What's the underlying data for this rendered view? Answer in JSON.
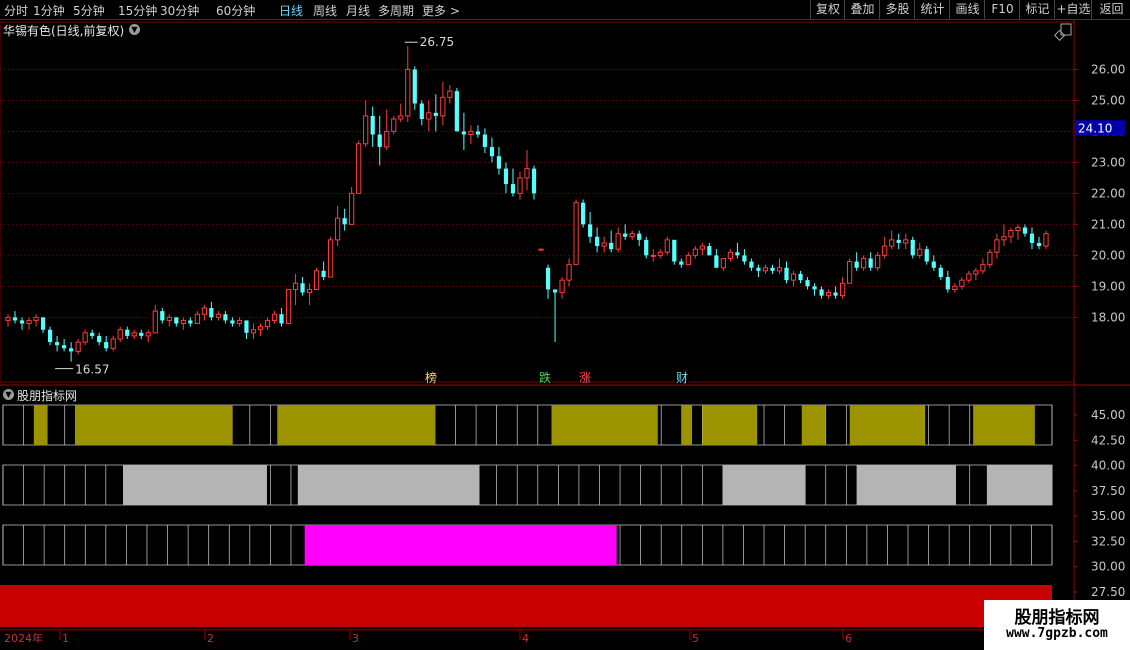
{
  "toolbar": {
    "periods": [
      "分时",
      "1分钟",
      "5分钟",
      "15分钟",
      "30分钟",
      "60分钟",
      "日线",
      "周线",
      "月线",
      "多周期",
      "更多 >"
    ],
    "active_period": "日线",
    "actions": [
      "复权",
      "叠加",
      "多股",
      "统计",
      "画线",
      "F10",
      "标记",
      "+自选",
      "返回"
    ]
  },
  "stock": {
    "title": "华锡有色(日线,前复权)",
    "last_price_label": "24.10",
    "max_label": "26.75",
    "min_label": "16.57"
  },
  "price_axis_labels": [
    "26.00",
    "25.00",
    "24.00",
    "23.00",
    "22.00",
    "21.00",
    "20.00",
    "19.00",
    "18.00"
  ],
  "event_markers": [
    {
      "label": "榜",
      "color": "#ffd27a"
    },
    {
      "label": "跌",
      "color": "#4cd84c"
    },
    {
      "label": "涨",
      "color": "#ff4a4a"
    },
    {
      "label": "财",
      "color": "#6ad7ff"
    }
  ],
  "indicator": {
    "title": "股朋指标网",
    "axis_labels": [
      "45.00",
      "42.50",
      "40.00",
      "37.50",
      "35.00",
      "32.50",
      "30.00",
      "27.50"
    ]
  },
  "time_axis": {
    "labels": [
      "2024年",
      "1",
      "2",
      "3",
      "4",
      "5",
      "6"
    ]
  },
  "watermark": {
    "title": "股朋指标网",
    "url": "www.7gpzb.com"
  },
  "colors": {
    "up": "#ff3c3c",
    "down": "#54ffff",
    "olive": "#9b9400",
    "gray": "#b4b4b4",
    "magenta": "#ff00ff",
    "red_band": "#c80000"
  },
  "chart_data": {
    "type": "candlestick",
    "ohlc": [
      [
        17.9,
        18.1,
        17.7,
        18.0
      ],
      [
        18.0,
        18.2,
        17.8,
        17.9
      ],
      [
        17.9,
        18.0,
        17.6,
        17.8
      ],
      [
        17.8,
        18.0,
        17.6,
        17.9
      ],
      [
        17.9,
        18.1,
        17.7,
        18.0
      ],
      [
        18.0,
        18.0,
        17.5,
        17.6
      ],
      [
        17.6,
        17.7,
        17.1,
        17.2
      ],
      [
        17.2,
        17.4,
        16.9,
        17.1
      ],
      [
        17.1,
        17.3,
        16.9,
        17.0
      ],
      [
        17.0,
        17.2,
        16.57,
        16.9
      ],
      [
        16.9,
        17.3,
        16.8,
        17.2
      ],
      [
        17.2,
        17.6,
        17.1,
        17.5
      ],
      [
        17.5,
        17.6,
        17.3,
        17.4
      ],
      [
        17.4,
        17.5,
        17.1,
        17.2
      ],
      [
        17.2,
        17.4,
        16.9,
        17.0
      ],
      [
        17.0,
        17.4,
        16.9,
        17.3
      ],
      [
        17.3,
        17.7,
        17.2,
        17.6
      ],
      [
        17.6,
        17.7,
        17.3,
        17.4
      ],
      [
        17.4,
        17.6,
        17.3,
        17.5
      ],
      [
        17.5,
        17.6,
        17.3,
        17.4
      ],
      [
        17.4,
        17.6,
        17.2,
        17.5
      ],
      [
        17.5,
        18.4,
        17.5,
        18.2
      ],
      [
        18.2,
        18.3,
        17.8,
        17.9
      ],
      [
        17.9,
        18.1,
        17.7,
        18.0
      ],
      [
        18.0,
        18.0,
        17.7,
        17.8
      ],
      [
        17.8,
        18.0,
        17.6,
        17.9
      ],
      [
        17.9,
        18.0,
        17.7,
        17.8
      ],
      [
        17.8,
        18.2,
        17.8,
        18.1
      ],
      [
        18.1,
        18.4,
        17.9,
        18.3
      ],
      [
        18.3,
        18.5,
        17.9,
        18.0
      ],
      [
        18.0,
        18.2,
        17.9,
        18.1
      ],
      [
        18.1,
        18.2,
        17.8,
        17.9
      ],
      [
        17.9,
        18.0,
        17.7,
        17.8
      ],
      [
        17.8,
        18.0,
        17.7,
        17.9
      ],
      [
        17.9,
        17.9,
        17.3,
        17.5
      ],
      [
        17.5,
        17.8,
        17.3,
        17.6
      ],
      [
        17.6,
        17.8,
        17.4,
        17.7
      ],
      [
        17.7,
        18.0,
        17.6,
        17.9
      ],
      [
        17.9,
        18.2,
        17.8,
        18.1
      ],
      [
        18.1,
        18.3,
        17.7,
        17.8
      ],
      [
        17.8,
        18.8,
        17.8,
        18.9
      ],
      [
        18.9,
        19.4,
        18.4,
        19.1
      ],
      [
        19.1,
        19.3,
        18.7,
        18.8
      ],
      [
        18.8,
        19.1,
        18.4,
        18.9
      ],
      [
        18.9,
        19.6,
        18.9,
        19.5
      ],
      [
        19.5,
        19.8,
        19.2,
        19.3
      ],
      [
        19.3,
        20.6,
        19.3,
        20.5
      ],
      [
        20.5,
        21.6,
        20.3,
        21.2
      ],
      [
        21.2,
        21.5,
        20.8,
        21.0
      ],
      [
        21.0,
        22.2,
        21.0,
        22.0
      ],
      [
        22.0,
        23.7,
        22.0,
        23.6
      ],
      [
        23.6,
        25.0,
        23.5,
        24.5
      ],
      [
        24.5,
        24.8,
        23.5,
        23.9
      ],
      [
        23.9,
        24.5,
        22.9,
        23.5
      ],
      [
        23.5,
        24.7,
        23.4,
        24.0
      ],
      [
        24.0,
        24.5,
        23.9,
        24.4
      ],
      [
        24.4,
        24.9,
        24.3,
        24.5
      ],
      [
        24.5,
        26.75,
        24.3,
        26.0
      ],
      [
        26.0,
        26.1,
        24.7,
        24.9
      ],
      [
        24.9,
        25.0,
        24.2,
        24.4
      ],
      [
        24.4,
        25.0,
        24.0,
        24.6
      ],
      [
        24.6,
        25.2,
        24.0,
        24.5
      ],
      [
        24.5,
        25.6,
        24.2,
        25.1
      ],
      [
        25.1,
        25.5,
        24.9,
        25.3
      ],
      [
        25.3,
        25.4,
        24.0,
        24.0
      ],
      [
        24.0,
        24.6,
        23.4,
        23.9
      ],
      [
        23.9,
        24.2,
        23.6,
        24.0
      ],
      [
        24.0,
        24.2,
        23.8,
        23.9
      ],
      [
        23.9,
        24.1,
        23.3,
        23.5
      ],
      [
        23.5,
        23.8,
        23.0,
        23.2
      ],
      [
        23.2,
        23.5,
        22.6,
        22.8
      ],
      [
        22.8,
        23.0,
        22.0,
        22.3
      ],
      [
        22.3,
        22.8,
        21.9,
        22.0
      ],
      [
        22.0,
        22.7,
        21.8,
        22.5
      ],
      [
        22.5,
        23.4,
        22.1,
        22.8
      ],
      [
        22.8,
        22.9,
        21.8,
        22.0
      ],
      [
        20.2,
        20.2,
        20.2,
        20.2
      ],
      [
        19.6,
        19.7,
        18.6,
        18.9
      ],
      [
        18.9,
        18.9,
        17.2,
        18.8
      ],
      [
        18.8,
        19.3,
        18.6,
        19.2
      ],
      [
        19.2,
        19.9,
        19.0,
        19.7
      ],
      [
        19.7,
        21.8,
        19.7,
        21.7
      ],
      [
        21.7,
        21.8,
        20.9,
        21.0
      ],
      [
        21.0,
        21.4,
        20.4,
        20.6
      ],
      [
        20.6,
        20.9,
        20.1,
        20.3
      ],
      [
        20.3,
        20.6,
        20.1,
        20.4
      ],
      [
        20.4,
        20.8,
        20.1,
        20.2
      ],
      [
        20.2,
        20.9,
        20.1,
        20.7
      ],
      [
        20.7,
        21.0,
        20.5,
        20.6
      ],
      [
        20.6,
        20.8,
        20.5,
        20.7
      ],
      [
        20.7,
        20.8,
        20.3,
        20.5
      ],
      [
        20.5,
        20.6,
        19.9,
        20.0
      ],
      [
        20.0,
        20.2,
        19.8,
        20.0
      ],
      [
        20.0,
        20.2,
        19.9,
        20.1
      ],
      [
        20.1,
        20.6,
        20.0,
        20.5
      ],
      [
        20.5,
        20.5,
        19.7,
        19.8
      ],
      [
        19.8,
        19.9,
        19.6,
        19.7
      ],
      [
        19.7,
        20.1,
        19.7,
        20.0
      ],
      [
        20.0,
        20.3,
        19.9,
        20.2
      ],
      [
        20.2,
        20.4,
        20.0,
        20.3
      ],
      [
        20.3,
        20.4,
        20.0,
        20.0
      ],
      [
        20.0,
        20.2,
        19.6,
        19.6
      ],
      [
        19.6,
        19.9,
        19.5,
        19.9
      ],
      [
        19.9,
        20.2,
        19.8,
        20.1
      ],
      [
        20.1,
        20.4,
        19.9,
        20.0
      ],
      [
        20.0,
        20.2,
        19.7,
        19.8
      ],
      [
        19.8,
        19.9,
        19.5,
        19.6
      ],
      [
        19.6,
        19.7,
        19.3,
        19.5
      ],
      [
        19.5,
        19.7,
        19.4,
        19.6
      ],
      [
        19.6,
        19.7,
        19.4,
        19.5
      ],
      [
        19.5,
        19.9,
        19.4,
        19.6
      ],
      [
        19.6,
        19.8,
        19.1,
        19.2
      ],
      [
        19.2,
        19.5,
        19.0,
        19.4
      ],
      [
        19.4,
        19.5,
        19.1,
        19.2
      ],
      [
        19.2,
        19.3,
        18.9,
        19.0
      ],
      [
        19.0,
        19.1,
        18.7,
        18.9
      ],
      [
        18.9,
        19.0,
        18.6,
        18.7
      ],
      [
        18.7,
        18.9,
        18.6,
        18.8
      ],
      [
        18.8,
        19.0,
        18.6,
        18.7
      ],
      [
        18.7,
        19.3,
        18.6,
        19.1
      ],
      [
        19.1,
        19.9,
        19.1,
        19.8
      ],
      [
        19.8,
        20.1,
        19.5,
        19.6
      ],
      [
        19.6,
        20.0,
        19.5,
        19.9
      ],
      [
        19.9,
        20.1,
        19.5,
        19.6
      ],
      [
        19.6,
        20.1,
        19.5,
        20.0
      ],
      [
        20.0,
        20.6,
        19.9,
        20.3
      ],
      [
        20.3,
        20.8,
        20.2,
        20.5
      ],
      [
        20.5,
        20.7,
        20.2,
        20.4
      ],
      [
        20.4,
        20.7,
        20.2,
        20.5
      ],
      [
        20.5,
        20.6,
        19.9,
        20.0
      ],
      [
        20.0,
        20.4,
        19.9,
        20.2
      ],
      [
        20.2,
        20.3,
        19.7,
        19.8
      ],
      [
        19.8,
        20.0,
        19.5,
        19.6
      ],
      [
        19.6,
        19.7,
        19.2,
        19.3
      ],
      [
        19.3,
        19.5,
        18.8,
        18.9
      ],
      [
        18.9,
        19.1,
        18.8,
        19.0
      ],
      [
        19.0,
        19.3,
        18.9,
        19.2
      ],
      [
        19.2,
        19.5,
        19.1,
        19.4
      ],
      [
        19.4,
        19.6,
        19.2,
        19.5
      ],
      [
        19.5,
        19.9,
        19.4,
        19.7
      ],
      [
        19.7,
        20.2,
        19.6,
        20.1
      ],
      [
        20.1,
        20.7,
        19.9,
        20.5
      ],
      [
        20.5,
        21.0,
        20.3,
        20.6
      ],
      [
        20.6,
        20.9,
        20.4,
        20.8
      ],
      [
        20.8,
        21.0,
        20.5,
        20.9
      ],
      [
        20.9,
        21.0,
        20.6,
        20.7
      ],
      [
        20.7,
        20.9,
        20.2,
        20.4
      ],
      [
        20.4,
        20.6,
        20.2,
        20.3
      ],
      [
        20.3,
        20.8,
        20.2,
        20.7
      ]
    ],
    "ylim": [
      16.3,
      26.95
    ],
    "indicator_bands": [
      {
        "color": "olive",
        "on_ranges": [
          [
            9,
            12
          ],
          [
            21,
            66
          ],
          [
            80,
            125
          ],
          [
            160,
            190
          ],
          [
            198,
            200
          ],
          [
            204,
            219
          ],
          [
            233,
            239
          ],
          [
            247,
            268
          ],
          [
            283,
            300
          ]
        ]
      },
      {
        "color": "gray",
        "on_ranges": [
          [
            35,
            76
          ],
          [
            86,
            138
          ],
          [
            210,
            233
          ],
          [
            249,
            277
          ],
          [
            287,
            305
          ]
        ]
      },
      {
        "color": "magenta",
        "on_ranges": [
          [
            88,
            178
          ]
        ]
      },
      {
        "color": "red_band",
        "on_ranges": [
          [
            0,
            305
          ]
        ]
      }
    ],
    "indicator_ylim": [
      26.0,
      46.5
    ]
  }
}
